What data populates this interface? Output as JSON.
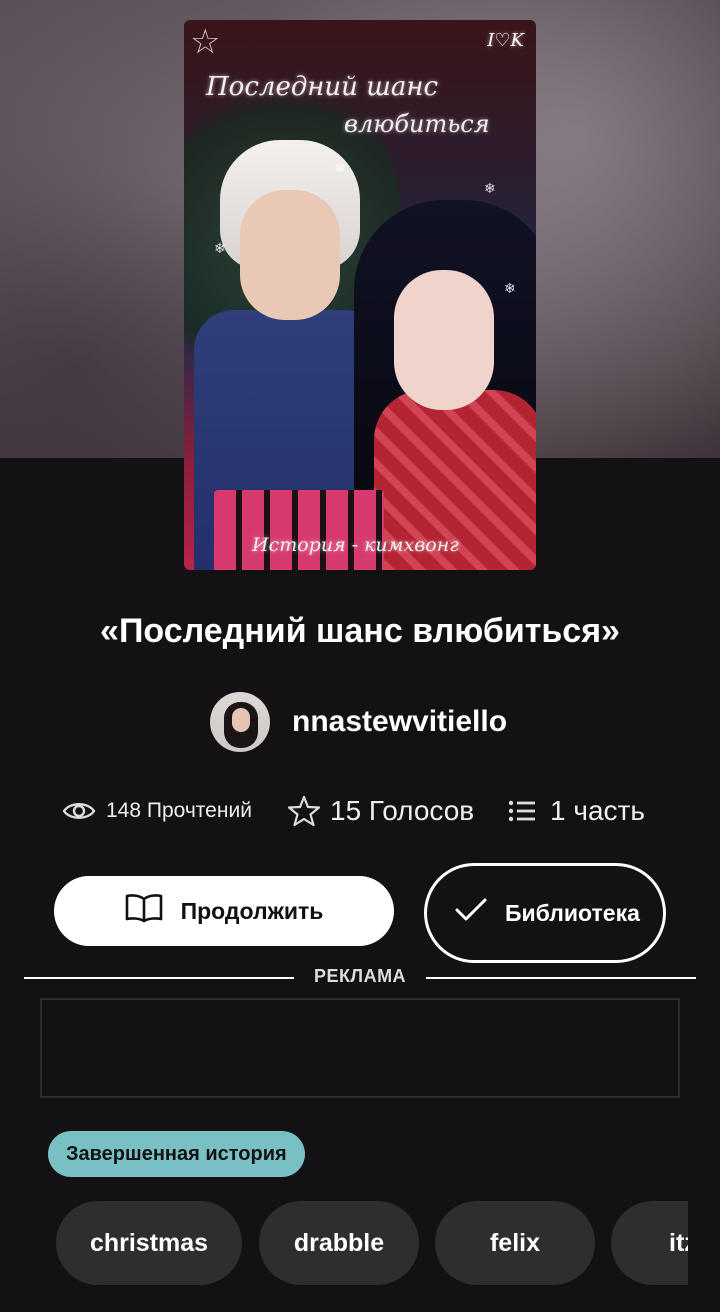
{
  "story": {
    "title": "«Последний шанс влюбиться»",
    "cover": {
      "line1": "Последний шанс",
      "line2": "влюбиться",
      "bottom_text": "История - кимхвонг",
      "corner_tag": "Ι♡K"
    }
  },
  "author": {
    "name": "nnastewvitiello"
  },
  "stats": {
    "reads_label": "148 Прочтений",
    "votes_label": "15 Голосов",
    "parts_label": "1 часть"
  },
  "actions": {
    "continue_label": "Продолжить",
    "library_label": "Библиотека"
  },
  "ad": {
    "label": "РЕКЛАМА"
  },
  "status_badge": "Завершенная история",
  "tags": [
    "christmas",
    "drabble",
    "felix",
    "itzy"
  ],
  "colors": {
    "badge": "#79c0c4",
    "background": "#131113",
    "chip": "#2f2d30"
  },
  "icons": [
    "eye-icon",
    "star-icon",
    "list-icon",
    "book-icon",
    "check-icon"
  ]
}
